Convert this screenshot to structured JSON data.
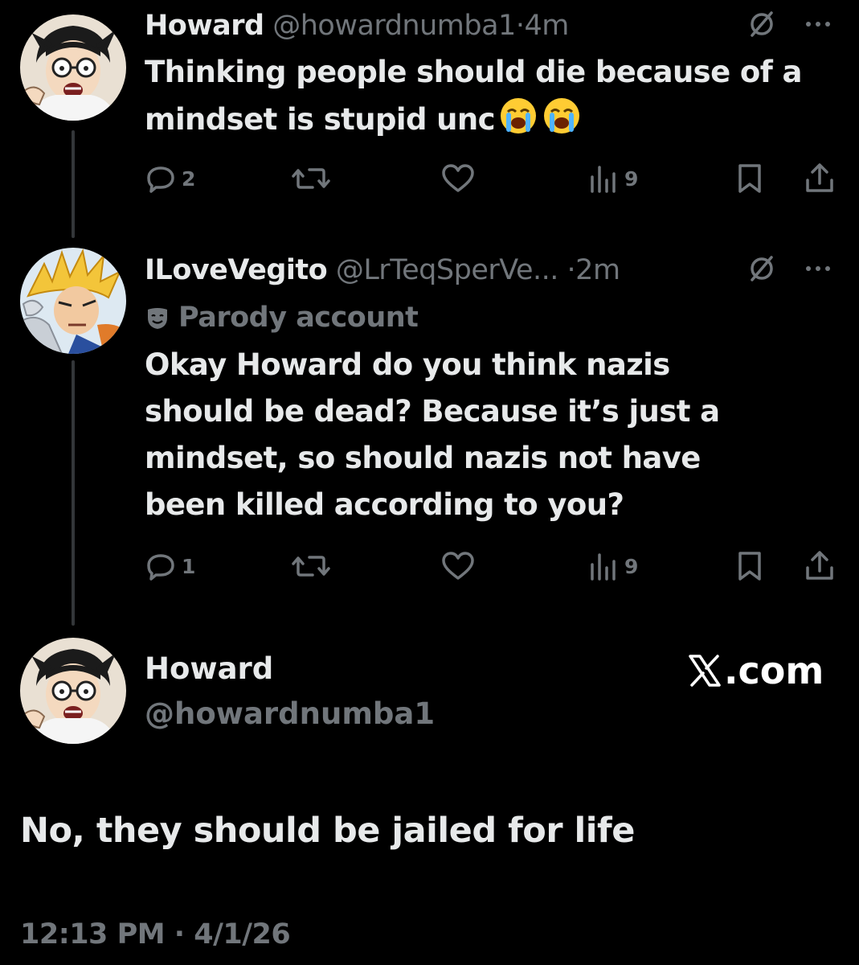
{
  "tweets": [
    {
      "name": "Howard",
      "handle": "@howardnumba1",
      "separator": "·",
      "time": "4m",
      "text": "Thinking people should die because of a mindset is stupid unc",
      "emoji": [
        "😭",
        "😭"
      ],
      "replies": "2",
      "views": "9"
    },
    {
      "name": "ILoveVegito",
      "handle": "@LrTeqSperVe...",
      "separator": "·",
      "time": "2m",
      "label": "Parody account",
      "text": "Okay Howard do you think nazis should be dead? Because it’s just a mindset, so should nazis not have been killed according to you?",
      "replies": "1",
      "views": "9"
    }
  ],
  "main_tweet": {
    "name": "Howard",
    "handle": "@howardnumba1",
    "text": "No, they should be jailed for life",
    "timestamp": "12:13 PM · 4/1/26"
  },
  "watermark": {
    "text": ".com"
  },
  "icons": {
    "muted": "slash-circle-icon",
    "more": "more-dots-icon",
    "reply": "reply-bubble-icon",
    "retweet": "retweet-icon",
    "like": "heart-icon",
    "views": "views-bar-chart-icon",
    "bookmark": "bookmark-icon",
    "share": "share-icon",
    "parody": "theater-mask-icon"
  },
  "colors": {
    "background": "#000000",
    "primary_text": "#e7e9ea",
    "secondary_text": "#71767b",
    "thread_line": "#333639"
  }
}
